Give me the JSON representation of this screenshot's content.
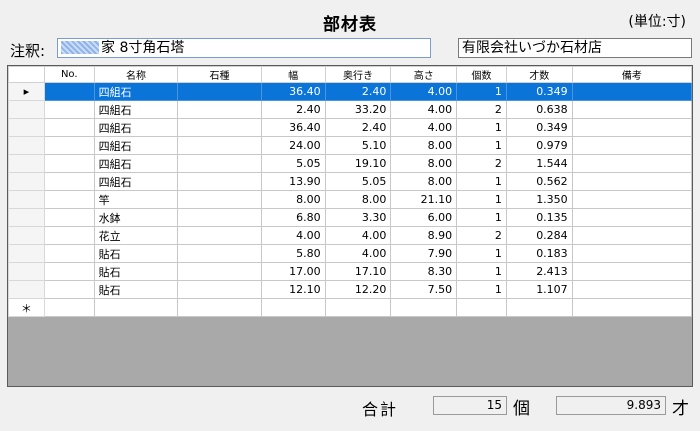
{
  "header": {
    "title": "部材表",
    "unit": "(単位:寸)"
  },
  "note": {
    "label": "注釈:",
    "value": "家 8寸角石塔"
  },
  "shop": {
    "name": "有限会社いづか石材店"
  },
  "table": {
    "columns": [
      "No.",
      "名称",
      "石種",
      "幅",
      "奥行き",
      "高さ",
      "個数",
      "才数",
      "備考"
    ],
    "rows": [
      {
        "no": "",
        "name": "四組石",
        "stone": "",
        "width": "36.40",
        "depth": "2.40",
        "height": "4.00",
        "count": "1",
        "sai": "0.349",
        "note": ""
      },
      {
        "no": "",
        "name": "四組石",
        "stone": "",
        "width": "2.40",
        "depth": "33.20",
        "height": "4.00",
        "count": "2",
        "sai": "0.638",
        "note": ""
      },
      {
        "no": "",
        "name": "四組石",
        "stone": "",
        "width": "36.40",
        "depth": "2.40",
        "height": "4.00",
        "count": "1",
        "sai": "0.349",
        "note": ""
      },
      {
        "no": "",
        "name": "四組石",
        "stone": "",
        "width": "24.00",
        "depth": "5.10",
        "height": "8.00",
        "count": "1",
        "sai": "0.979",
        "note": ""
      },
      {
        "no": "",
        "name": "四組石",
        "stone": "",
        "width": "5.05",
        "depth": "19.10",
        "height": "8.00",
        "count": "2",
        "sai": "1.544",
        "note": ""
      },
      {
        "no": "",
        "name": "四組石",
        "stone": "",
        "width": "13.90",
        "depth": "5.05",
        "height": "8.00",
        "count": "1",
        "sai": "0.562",
        "note": ""
      },
      {
        "no": "",
        "name": "竿",
        "stone": "",
        "width": "8.00",
        "depth": "8.00",
        "height": "21.10",
        "count": "1",
        "sai": "1.350",
        "note": ""
      },
      {
        "no": "",
        "name": "水鉢",
        "stone": "",
        "width": "6.80",
        "depth": "3.30",
        "height": "6.00",
        "count": "1",
        "sai": "0.135",
        "note": ""
      },
      {
        "no": "",
        "name": "花立",
        "stone": "",
        "width": "4.00",
        "depth": "4.00",
        "height": "8.90",
        "count": "2",
        "sai": "0.284",
        "note": ""
      },
      {
        "no": "",
        "name": "貼石",
        "stone": "",
        "width": "5.80",
        "depth": "4.00",
        "height": "7.90",
        "count": "1",
        "sai": "0.183",
        "note": ""
      },
      {
        "no": "",
        "name": "貼石",
        "stone": "",
        "width": "17.00",
        "depth": "17.10",
        "height": "8.30",
        "count": "1",
        "sai": "2.413",
        "note": ""
      },
      {
        "no": "",
        "name": "貼石",
        "stone": "",
        "width": "12.10",
        "depth": "12.20",
        "height": "7.50",
        "count": "1",
        "sai": "1.107",
        "note": ""
      }
    ],
    "row_indicator": "▸",
    "new_row_marker": "＊"
  },
  "summary": {
    "label": "合計",
    "count_value": "15",
    "count_unit": "個",
    "sai_value": "9.893",
    "sai_unit": "才"
  },
  "colors": {
    "selection": "#0a74d8",
    "grid_empty": "#a9a9a9"
  }
}
